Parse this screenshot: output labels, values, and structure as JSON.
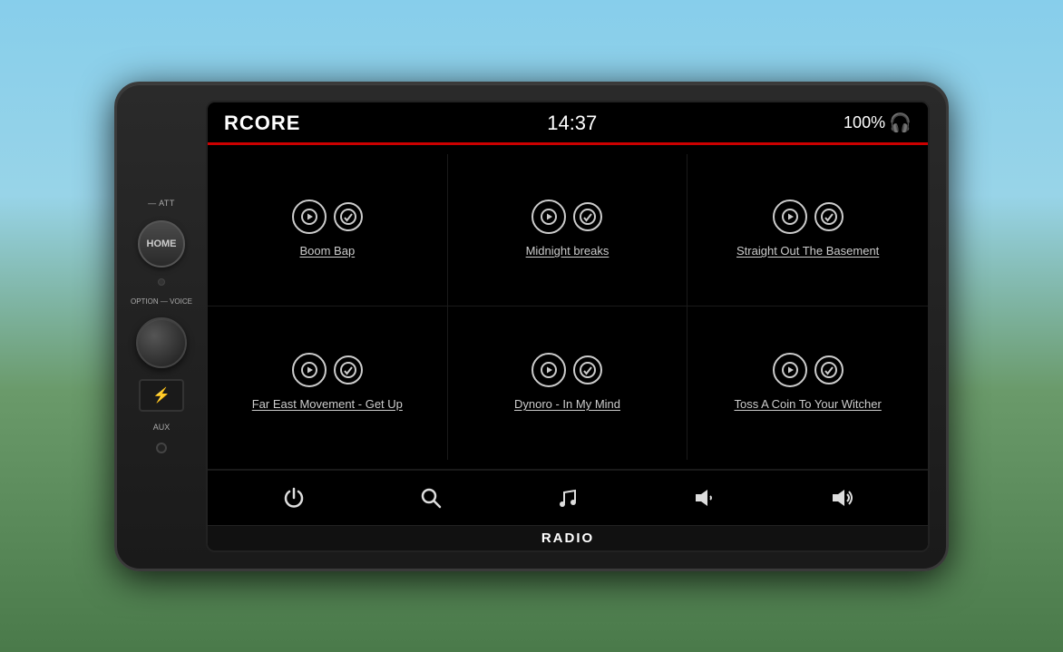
{
  "header": {
    "title": "RCORE",
    "time": "14:37",
    "volume": "100%"
  },
  "songs": [
    {
      "id": 1,
      "title": "Boom Bap"
    },
    {
      "id": 2,
      "title": "Midnight breaks"
    },
    {
      "id": 3,
      "title": "Straight Out The Basement"
    },
    {
      "id": 4,
      "title": "Far East Movement - Get Up"
    },
    {
      "id": 5,
      "title": "Dynoro - In My Mind"
    },
    {
      "id": 6,
      "title": "Toss A Coin To Your Witcher"
    }
  ],
  "controls": {
    "left": {
      "att_label": "— ATT",
      "home_label": "HOME",
      "option_label": "OPTION\n— VOICE",
      "aux_label": "AUX"
    },
    "bottom": [
      {
        "id": "power",
        "icon": "⏻",
        "label": "power"
      },
      {
        "id": "search",
        "icon": "🔍",
        "label": "search"
      },
      {
        "id": "music",
        "icon": "♪",
        "label": "music"
      },
      {
        "id": "vol-down",
        "icon": "🔈",
        "label": "volume-down"
      },
      {
        "id": "vol-up",
        "icon": "🔊",
        "label": "volume-up"
      }
    ]
  },
  "footer": {
    "label": "RADIO"
  }
}
